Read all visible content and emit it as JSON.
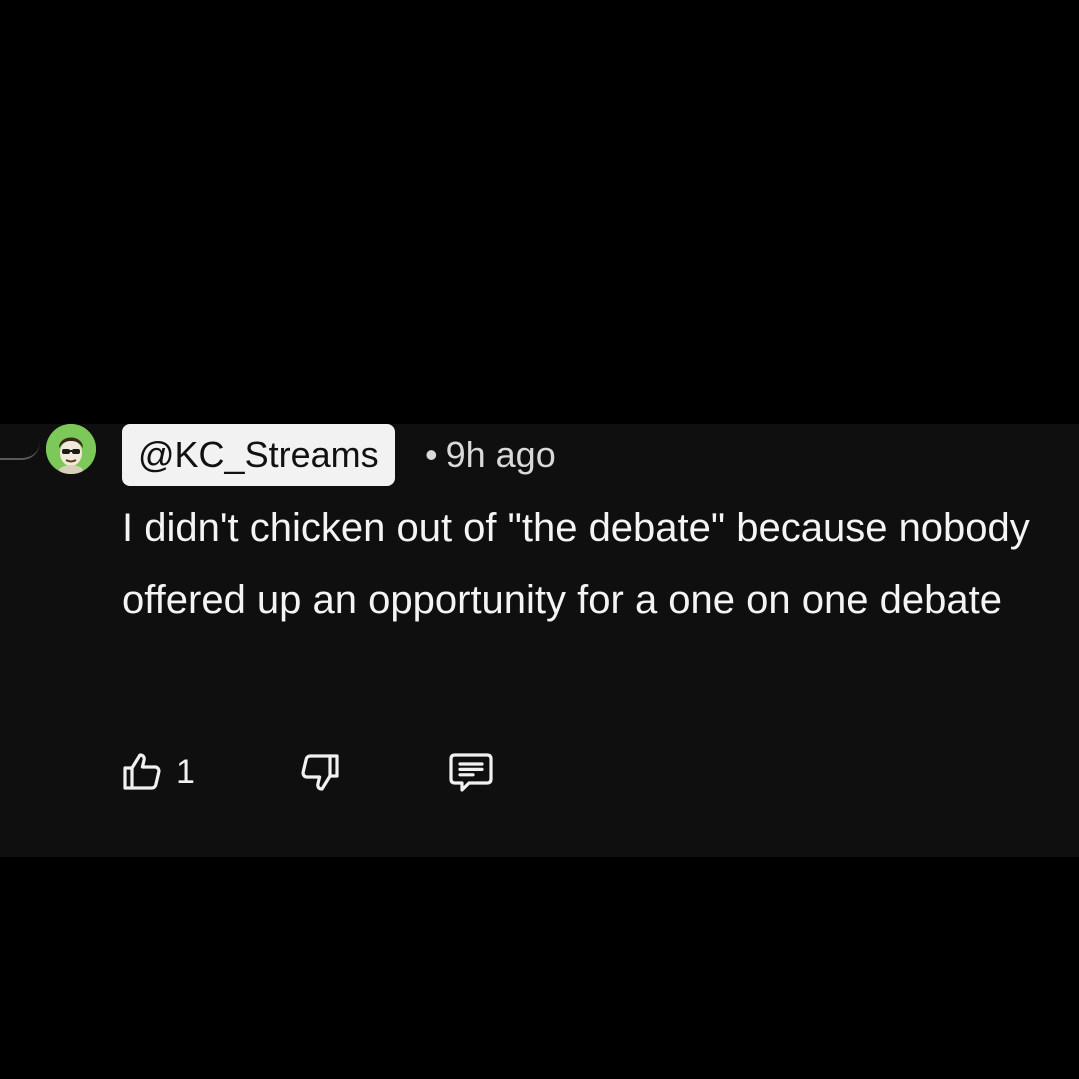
{
  "comment": {
    "author": "@KC_Streams",
    "separator": "•",
    "timestamp": "9h ago",
    "text": "I didn't chicken out of \"the debate\" because nobody offered up an opportunity for a one on one debate",
    "like_count": "1"
  },
  "icons": {
    "like": "thumbs-up-icon",
    "dislike": "thumbs-down-icon",
    "reply": "comment-icon"
  },
  "colors": {
    "background": "#000000",
    "card": "#0f0f0f",
    "text": "#f1f1f1",
    "author_chip": "#f2f2f2",
    "avatar": "#7cc95a"
  }
}
